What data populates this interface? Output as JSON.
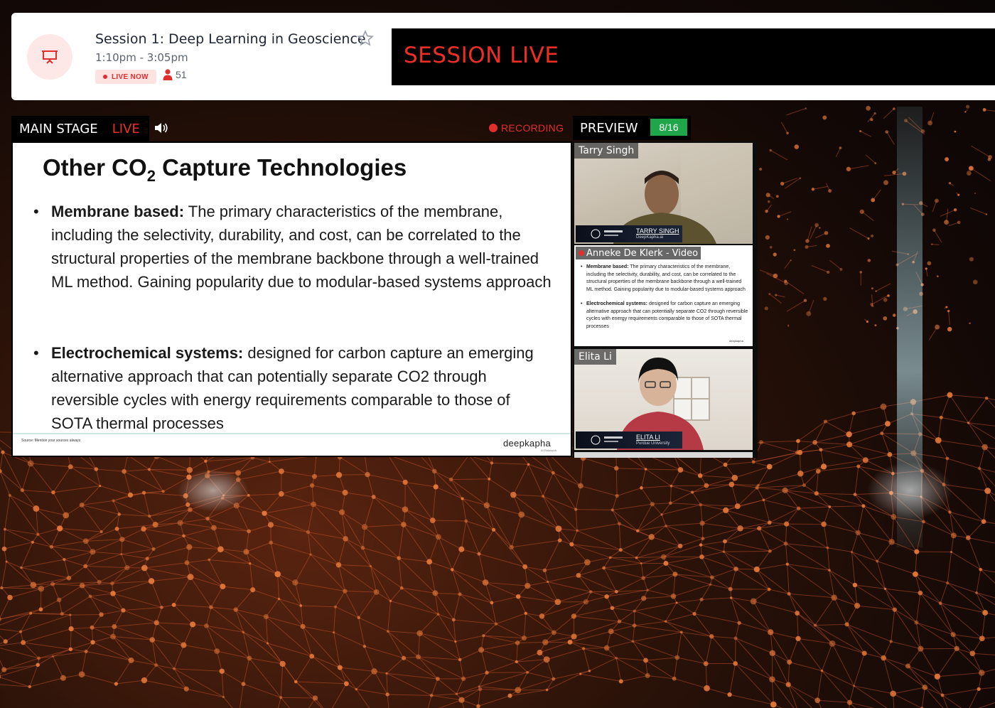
{
  "session": {
    "title": "Session 1: Deep Learning in Geoscience",
    "time": "1:10pm - 3:05pm",
    "live_badge": "LIVE NOW",
    "attendee_count": "51",
    "banner_text": "SESSION LIVE"
  },
  "stage": {
    "label": "MAIN STAGE",
    "live_label": "LIVE",
    "recording_label": "RECORDING"
  },
  "preview": {
    "label": "PREVIEW",
    "count": "8/16"
  },
  "slide": {
    "title_main": "Other CO",
    "title_sub": "2",
    "title_rest": " Capture Technologies",
    "bullets": [
      {
        "heading": "Membrane based:",
        "text": " The primary characteristics of the membrane, including the selectivity, durability, and cost, can be correlated to the structural properties of the membrane backbone through a well-trained ML method. Gaining popularity due to modular-based systems approach"
      },
      {
        "heading": "Electrochemical systems:",
        "text": " designed for carbon capture an emerging alternative approach that can potentially separate CO2 through reversible cycles with energy requirements comparable to those of SOTA thermal processes"
      }
    ],
    "source": "Source: Mention your sources always",
    "logo": "deepkapha",
    "logo_sub": "AI Research"
  },
  "tiles": [
    {
      "name": "Tarry Singh",
      "lower_name": "TARRY SINGH",
      "lower_org": "DeepKapha.ai"
    },
    {
      "name": "Anneke De Klerk - Video",
      "mini_bullets": [
        {
          "heading": "Membrane based:",
          "text": " The primary characteristics of the membrane, including the selectivity, durability, and cost, can be correlated to the structural properties of the membrane backbone through a well-trained ML method. Gaining popularity due to modular-based systems approach"
        },
        {
          "heading": "Electrochemical systems:",
          "text": " designed for carbon capture an emerging alternative approach that can potentially separate CO2 through reversible cycles with energy requirements comparable to those of SOTA thermal processes"
        }
      ],
      "mini_logo": "deepkapha"
    },
    {
      "name": "Elita Li",
      "lower_name": "ELITA LI",
      "lower_org": "Purdue University"
    }
  ],
  "colors": {
    "live_red": "#ee2e24",
    "preview_green": "#1fa64a",
    "banner_black": "#000000"
  },
  "icons": {
    "session": "presentation-board-icon",
    "favorite": "star-outline-icon",
    "attendees": "person-icon",
    "audio": "speaker-icon",
    "recording": "record-dot-icon"
  }
}
